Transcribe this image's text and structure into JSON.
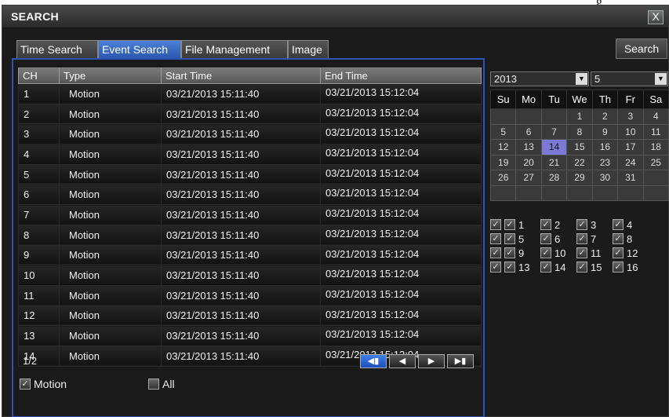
{
  "window": {
    "title": "SEARCH",
    "close_label": "X"
  },
  "tabs": [
    {
      "label": "Time Search",
      "active": false
    },
    {
      "label": "Event Search",
      "active": true
    },
    {
      "label": "File Management",
      "active": false
    },
    {
      "label": "Image",
      "active": false
    }
  ],
  "search_button": "Search",
  "table": {
    "columns": [
      "CH",
      "Type",
      "Start Time",
      "End Time"
    ],
    "rows": [
      {
        "ch": "1",
        "type": "Motion",
        "start": "03/21/2013 15:11:40",
        "end": "03/21/2013 15:12:04"
      },
      {
        "ch": "2",
        "type": "Motion",
        "start": "03/21/2013 15:11:40",
        "end": "03/21/2013 15:12:04"
      },
      {
        "ch": "3",
        "type": "Motion",
        "start": "03/21/2013 15:11:40",
        "end": "03/21/2013 15:12:04"
      },
      {
        "ch": "4",
        "type": "Motion",
        "start": "03/21/2013 15:11:40",
        "end": "03/21/2013 15:12:04"
      },
      {
        "ch": "5",
        "type": "Motion",
        "start": "03/21/2013 15:11:40",
        "end": "03/21/2013 15:12:04"
      },
      {
        "ch": "6",
        "type": "Motion",
        "start": "03/21/2013 15:11:40",
        "end": "03/21/2013 15:12:04"
      },
      {
        "ch": "7",
        "type": "Motion",
        "start": "03/21/2013 15:11:40",
        "end": "03/21/2013 15:12:04"
      },
      {
        "ch": "8",
        "type": "Motion",
        "start": "03/21/2013 15:11:40",
        "end": "03/21/2013 15:12:04"
      },
      {
        "ch": "9",
        "type": "Motion",
        "start": "03/21/2013 15:11:40",
        "end": "03/21/2013 15:12:04"
      },
      {
        "ch": "10",
        "type": "Motion",
        "start": "03/21/2013 15:11:40",
        "end": "03/21/2013 15:12:04"
      },
      {
        "ch": "11",
        "type": "Motion",
        "start": "03/21/2013 15:11:40",
        "end": "03/21/2013 15:12:04"
      },
      {
        "ch": "12",
        "type": "Motion",
        "start": "03/21/2013 15:11:40",
        "end": "03/21/2013 15:12:04"
      },
      {
        "ch": "13",
        "type": "Motion",
        "start": "03/21/2013 15:11:40",
        "end": "03/21/2013 15:12:04"
      },
      {
        "ch": "14",
        "type": "Motion",
        "start": "03/21/2013 15:11:40",
        "end": "03/21/2013 15:12:04"
      }
    ]
  },
  "pagination": {
    "page": "1/2"
  },
  "filters": [
    {
      "label": "Motion",
      "checked": true
    },
    {
      "label": "All",
      "checked": false
    }
  ],
  "calendar": {
    "year": "2013",
    "month": "5",
    "weekdays": [
      "Su",
      "Mo",
      "Tu",
      "We",
      "Th",
      "Fr",
      "Sa"
    ],
    "weeks": [
      [
        "",
        "",
        "",
        "1",
        "2",
        "3",
        "4"
      ],
      [
        "5",
        "6",
        "7",
        "8",
        "9",
        "10",
        "11"
      ],
      [
        "12",
        "13",
        "14",
        "15",
        "16",
        "17",
        "18"
      ],
      [
        "19",
        "20",
        "21",
        "22",
        "23",
        "24",
        "25"
      ],
      [
        "26",
        "27",
        "28",
        "29",
        "30",
        "31",
        ""
      ],
      [
        "",
        "",
        "",
        "",
        "",
        "",
        ""
      ]
    ],
    "selected_day": "14"
  },
  "channels": [
    "1",
    "2",
    "3",
    "4",
    "5",
    "6",
    "7",
    "8",
    "9",
    "10",
    "11",
    "12",
    "13",
    "14",
    "15",
    "16"
  ],
  "colors": {
    "accent": "#2d54b0",
    "tab_active": "#3a6cc8",
    "selected_day": "#7c79d6"
  },
  "top_fragment": "g"
}
